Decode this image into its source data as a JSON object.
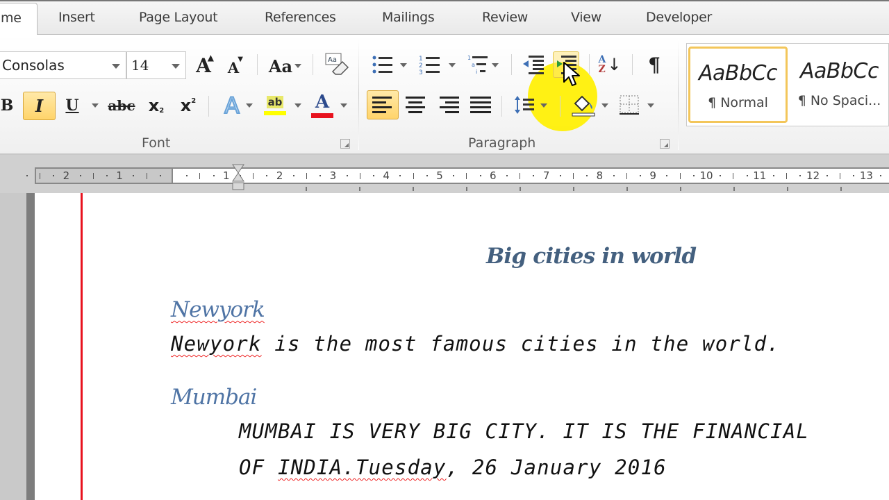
{
  "tabs": [
    {
      "label": "me",
      "active": true
    },
    {
      "label": "Insert"
    },
    {
      "label": "Page Layout"
    },
    {
      "label": "References"
    },
    {
      "label": "Mailings"
    },
    {
      "label": "Review"
    },
    {
      "label": "View"
    },
    {
      "label": "Developer"
    }
  ],
  "font_group": {
    "label": "Font",
    "font_name": "Consolas",
    "font_size": "14",
    "grow_font": "A",
    "shrink_font": "A",
    "change_case": "Aa",
    "bold": "B",
    "italic": "I",
    "underline": "U",
    "strikethrough": "abc",
    "subscript": "x",
    "subscript_mark": "2",
    "superscript": "x",
    "superscript_mark": "2",
    "text_effects": "A",
    "highlight": "ab",
    "font_color": "A",
    "highlight_color": "#ffff00",
    "font_color_value": "#e8121e"
  },
  "paragraph_group": {
    "label": "Paragraph",
    "pilcrow": "¶",
    "sort_a": "A",
    "sort_z": "Z"
  },
  "styles": [
    {
      "sample": "AaBbCc",
      "name": "¶ Normal",
      "selected": true
    },
    {
      "sample": "AaBbCc",
      "name": "¶ No Spaci..."
    }
  ],
  "ruler": {
    "left_numbers": [
      "2",
      "1"
    ],
    "right_numbers": [
      "1",
      "2",
      "3",
      "4",
      "5",
      "6",
      "7",
      "8",
      "9",
      "10",
      "11",
      "12",
      "13"
    ]
  },
  "document": {
    "title": "Big cities in world",
    "sections": [
      {
        "heading": "Newyork",
        "lines": [
          {
            "misspelled": "Newyork",
            "text": " is the most famous cities in the world."
          }
        ]
      },
      {
        "heading": "Mumbai",
        "lines": [
          {
            "text": "MUMBAI IS VERY BIG CITY. IT IS THE FINANCIAL"
          },
          {
            "prefix": "OF ",
            "misspelled": "INDIA.Tuesday",
            "text": ", 26 January 2016"
          }
        ]
      }
    ]
  },
  "colors": {
    "heading": "#4f74a5",
    "title": "#44607f",
    "selection_accent": "#ffd46b",
    "margin_line": "#e8121e",
    "cursor_highlight": "#fff000"
  }
}
